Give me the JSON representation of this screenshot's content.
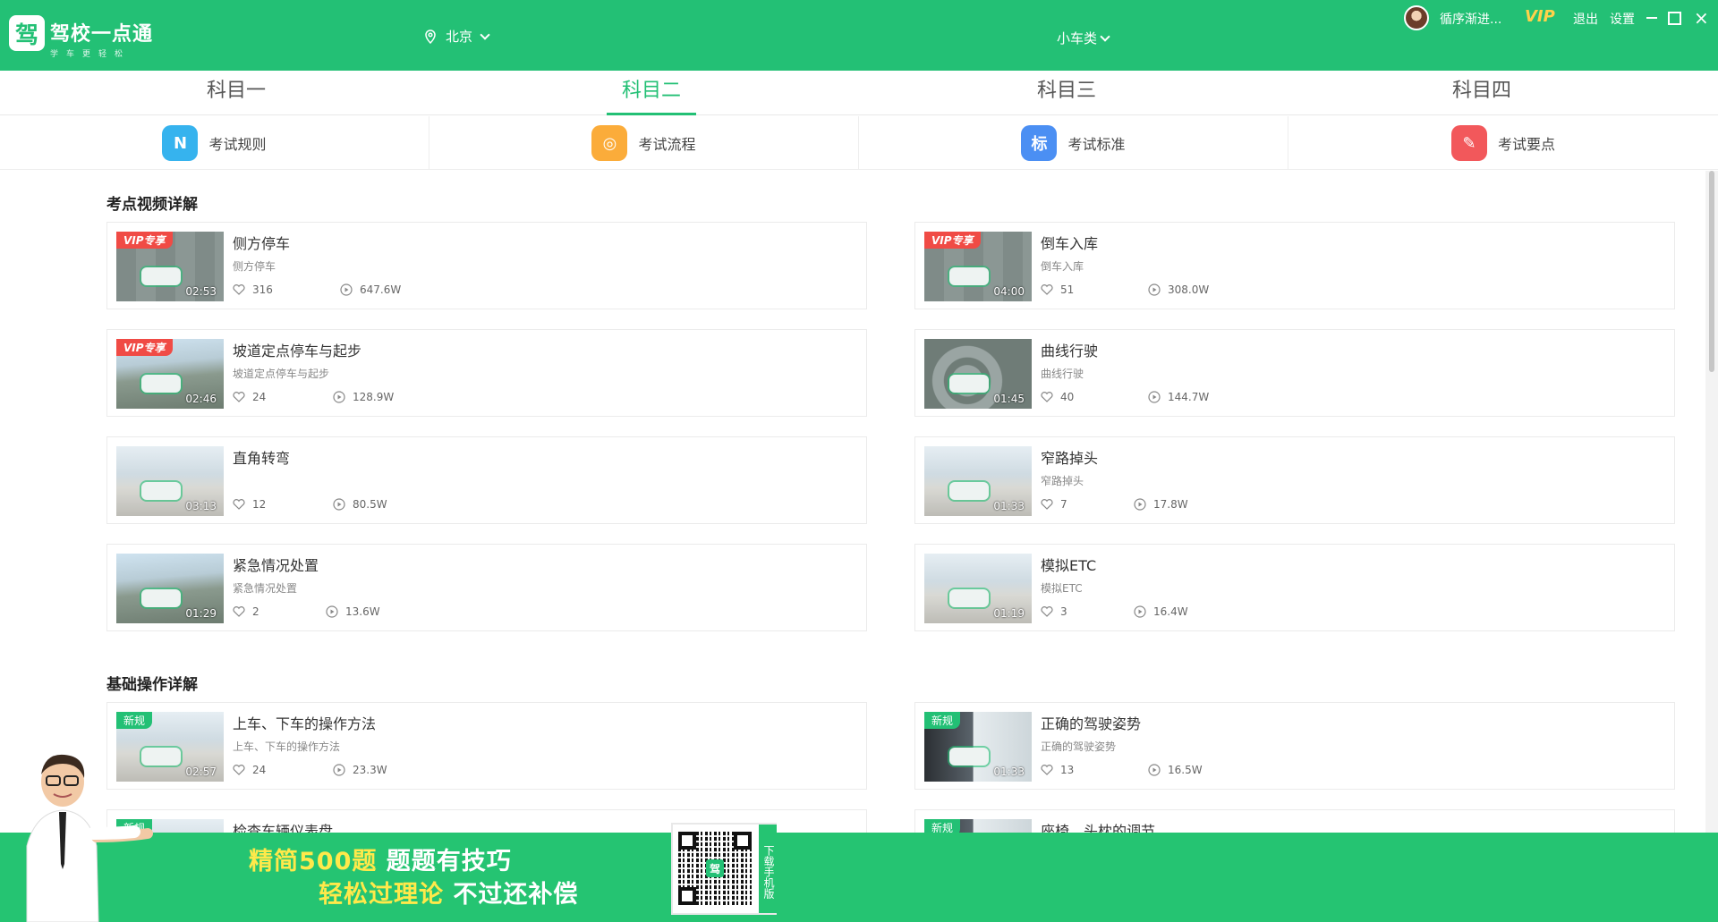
{
  "app": {
    "logo_char": "驾",
    "name": "驾校一点通",
    "tagline": "学车更轻松"
  },
  "header": {
    "city": "北京",
    "car_type": "小车类",
    "username": "循序渐进...",
    "vip": "VIP",
    "logout": "退出",
    "settings": "设置",
    "close_glyph": "×"
  },
  "subject_tabs": [
    "科目一",
    "科目二",
    "科目三",
    "科目四"
  ],
  "active_tab": "科目二",
  "info_items": [
    {
      "label": "考试规则",
      "icon": "rules-icon",
      "glyph": "N",
      "color": "#36b3ee"
    },
    {
      "label": "考试流程",
      "icon": "flow-icon",
      "glyph": "◎",
      "color": "#fbac3a"
    },
    {
      "label": "考试标准",
      "icon": "standard-icon",
      "glyph": "标",
      "color": "#4b8ff3"
    },
    {
      "label": "考试要点",
      "icon": "keypoint-icon",
      "glyph": "✎",
      "color": "#f2585b"
    }
  ],
  "sections": [
    {
      "title": "考点视频详解",
      "videos": [
        {
          "title": "侧方停车",
          "subtitle": "侧方停车",
          "badge": "VIP专享",
          "duration": "02:53",
          "likes": "316",
          "views": "647.6W"
        },
        {
          "title": "倒车入库",
          "subtitle": "倒车入库",
          "badge": "VIP专享",
          "duration": "04:00",
          "likes": "51",
          "views": "308.0W"
        },
        {
          "title": "坡道定点停车与起步",
          "subtitle": "坡道定点停车与起步",
          "badge": "VIP专享",
          "duration": "02:46",
          "likes": "24",
          "views": "128.9W"
        },
        {
          "title": "曲线行驶",
          "subtitle": "曲线行驶",
          "badge": "",
          "duration": "01:45",
          "likes": "40",
          "views": "144.7W"
        },
        {
          "title": "直角转弯",
          "subtitle": "",
          "badge": "",
          "duration": "03:13",
          "likes": "12",
          "views": "80.5W"
        },
        {
          "title": "窄路掉头",
          "subtitle": "窄路掉头",
          "badge": "",
          "duration": "01:33",
          "likes": "7",
          "views": "17.8W"
        },
        {
          "title": "紧急情况处置",
          "subtitle": "紧急情况处置",
          "badge": "",
          "duration": "01:29",
          "likes": "2",
          "views": "13.6W"
        },
        {
          "title": "模拟ETC",
          "subtitle": "模拟ETC",
          "badge": "",
          "duration": "01:19",
          "likes": "3",
          "views": "16.4W"
        }
      ]
    },
    {
      "title": "基础操作详解",
      "videos": [
        {
          "title": "上车、下车的操作方法",
          "subtitle": "上车、下车的操作方法",
          "badge": "新规",
          "duration": "02:57",
          "likes": "24",
          "views": "23.3W"
        },
        {
          "title": "正确的驾驶姿势",
          "subtitle": "正确的驾驶姿势",
          "badge": "新规",
          "duration": "01:33",
          "likes": "13",
          "views": "16.5W"
        },
        {
          "title": "检查车辆仪表盘",
          "subtitle": "",
          "badge": "新规",
          "duration": "",
          "likes": "",
          "views": ""
        },
        {
          "title": "座椅、头枕的调节",
          "subtitle": "",
          "badge": "新规",
          "duration": "",
          "likes": "",
          "views": ""
        }
      ]
    }
  ],
  "banner": {
    "slogan_part1": "精简500题",
    "slogan_part2": "题题有技巧",
    "slogan_part3": "轻松过理论",
    "slogan_part4": "不过还补偿",
    "qr_text": "下载手机版",
    "qr_logo": "驾"
  }
}
